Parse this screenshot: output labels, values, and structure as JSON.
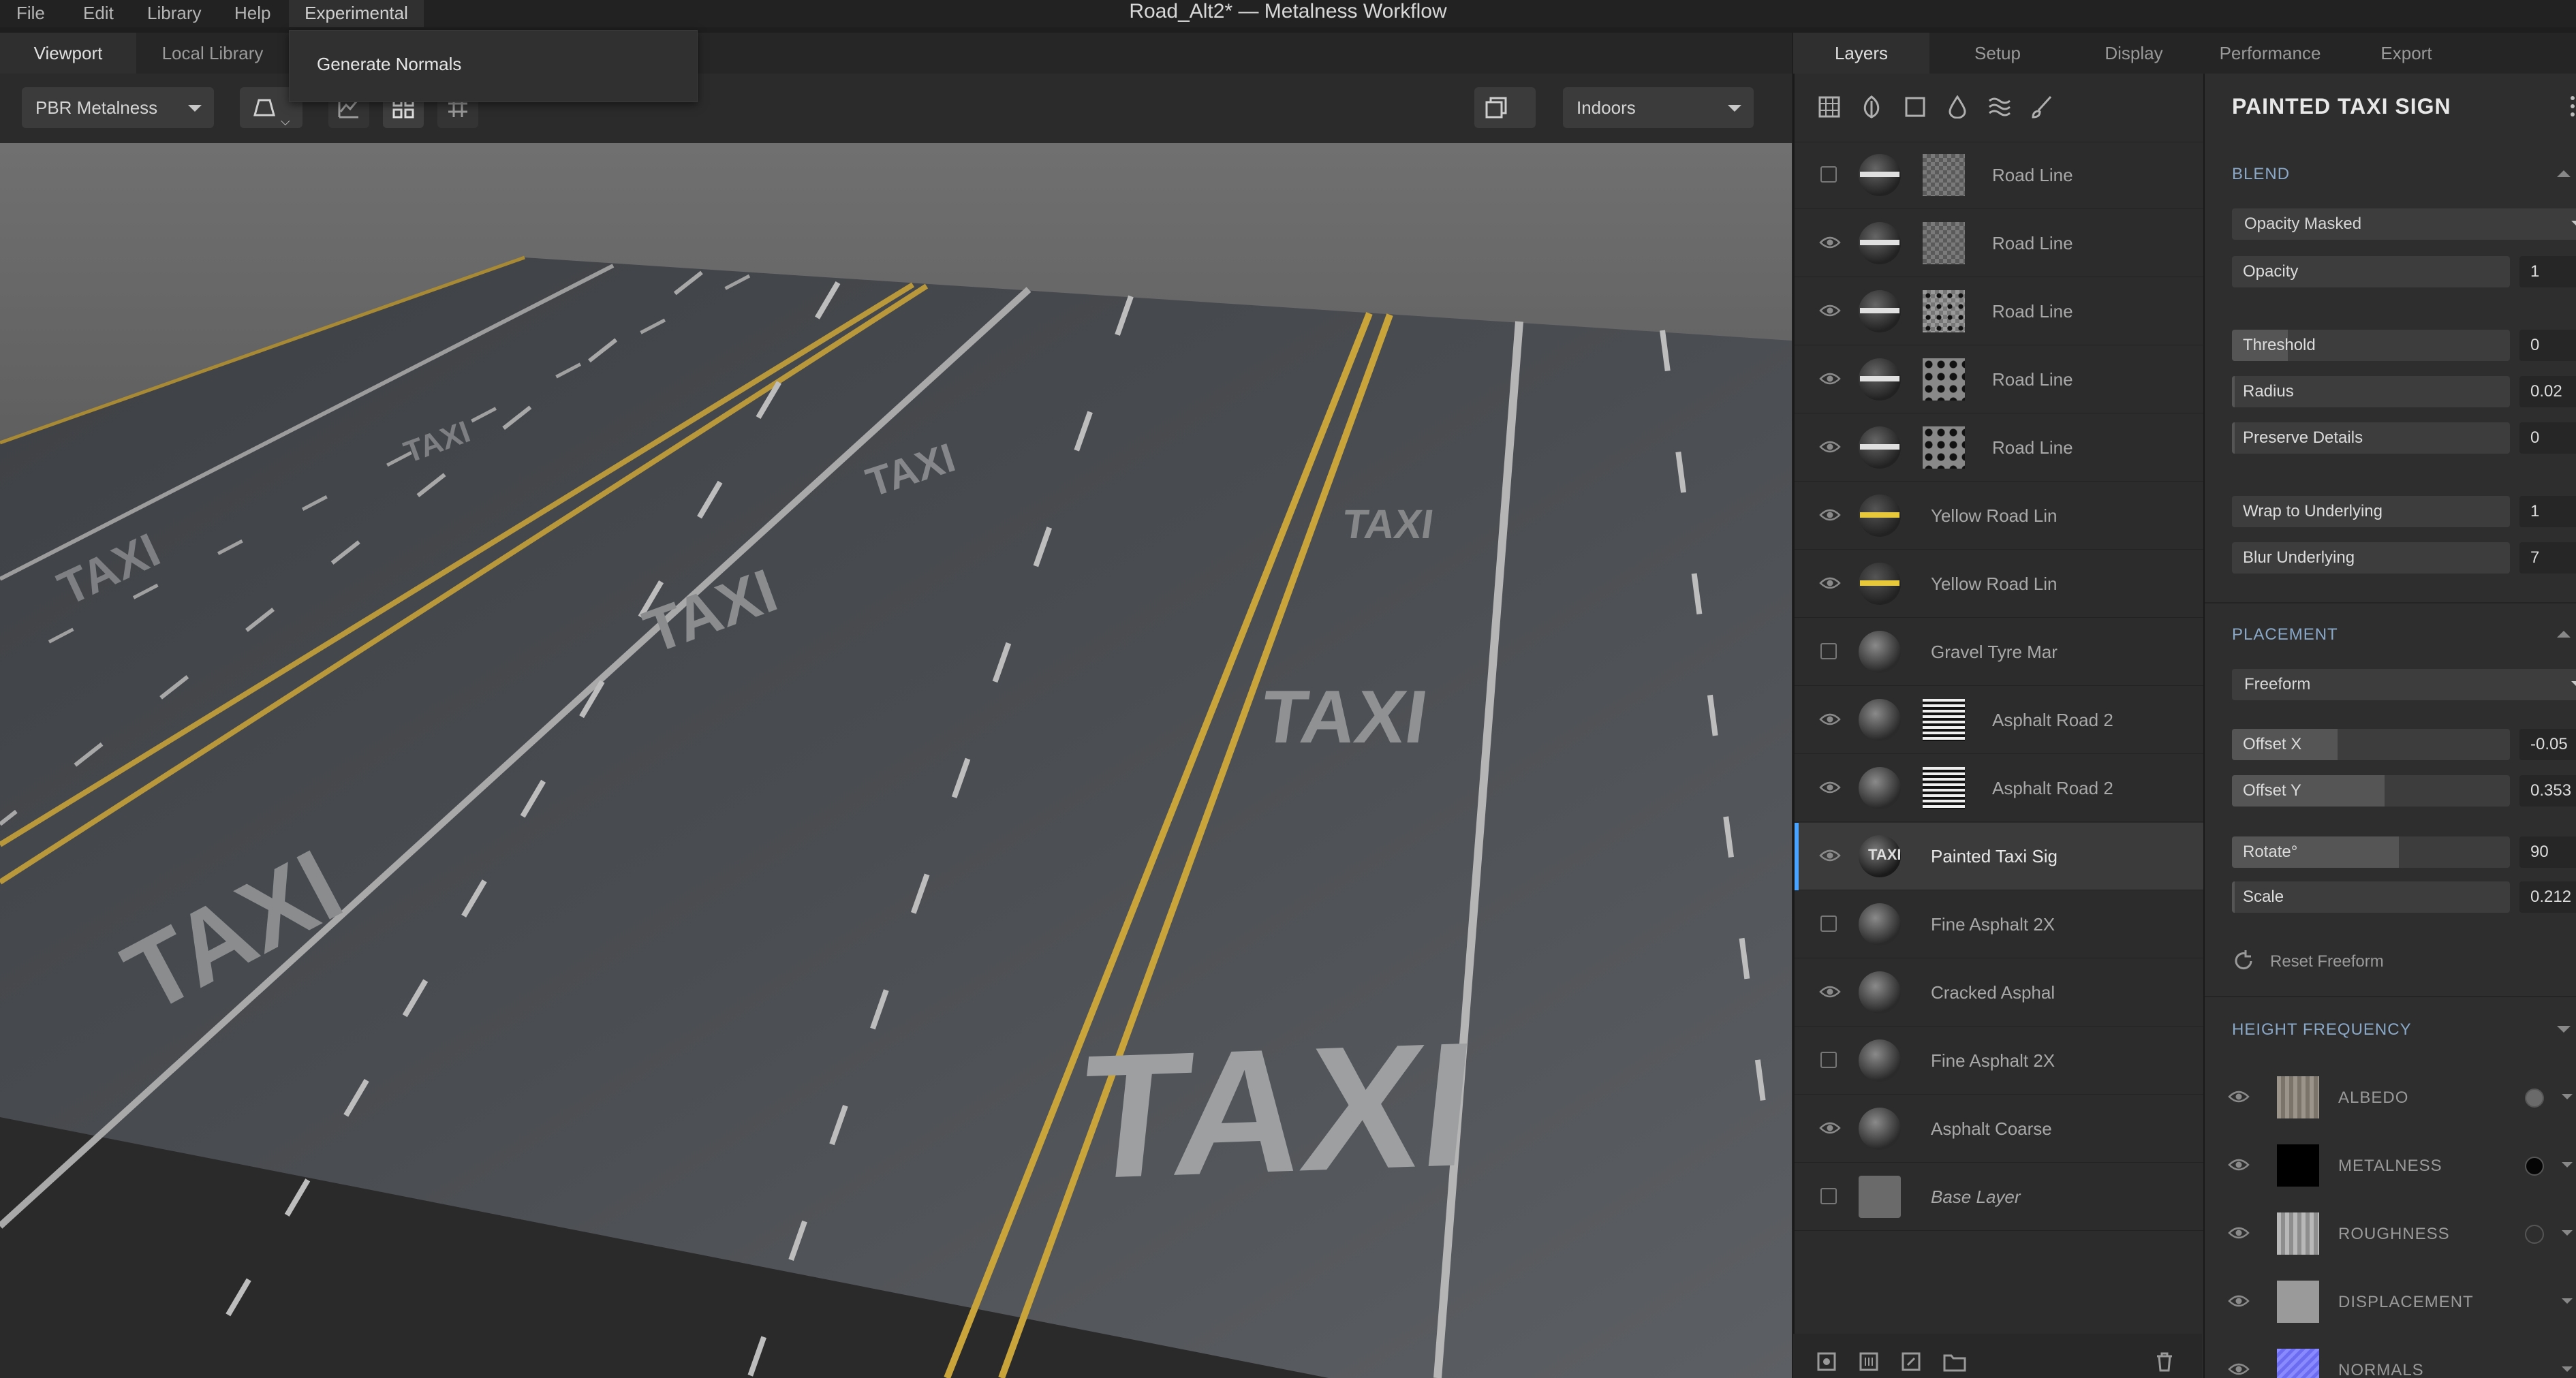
{
  "window": {
    "title": "Road_Alt2* — Metalness Workflow"
  },
  "menu": {
    "items": [
      "File",
      "Edit",
      "Library",
      "Help",
      "Experimental"
    ]
  },
  "experimental_menu": {
    "item": "Generate Normals"
  },
  "viewport_tabs": [
    "Viewport",
    "Local Library"
  ],
  "toolbar": {
    "shader": "PBR Metalness",
    "environment": "Indoors"
  },
  "right_tabs": [
    "Layers",
    "Setup",
    "Display",
    "Performance",
    "Export"
  ],
  "layers": [
    {
      "name": "Road Line",
      "visible": false,
      "mask": "checker"
    },
    {
      "name": "Road Line",
      "visible": true,
      "mask": "checker"
    },
    {
      "name": "Road Line",
      "visible": true,
      "mask": "dots"
    },
    {
      "name": "Road Line",
      "visible": true,
      "mask": "dots2"
    },
    {
      "name": "Road Line",
      "visible": true,
      "mask": "dots2"
    },
    {
      "name": "Yellow Road Lin",
      "visible": true,
      "mask": ""
    },
    {
      "name": "Yellow Road Lin",
      "visible": true,
      "mask": ""
    },
    {
      "name": "Gravel Tyre Mar",
      "visible": false,
      "mask": ""
    },
    {
      "name": "Asphalt Road 2",
      "visible": true,
      "mask": "stripes"
    },
    {
      "name": "Asphalt Road 2",
      "visible": true,
      "mask": "stripes"
    },
    {
      "name": "Painted Taxi Sig",
      "visible": true,
      "mask": "",
      "selected": true
    },
    {
      "name": "Fine Asphalt 2X",
      "visible": false,
      "mask": ""
    },
    {
      "name": "Cracked Asphal",
      "visible": true,
      "mask": ""
    },
    {
      "name": "Fine Asphalt 2X",
      "visible": false,
      "mask": ""
    },
    {
      "name": "Asphalt Coarse",
      "visible": true,
      "mask": ""
    },
    {
      "name": "Base Layer",
      "visible": false,
      "mask": "",
      "base": true
    }
  ],
  "properties": {
    "title": "PAINTED TAXI SIGN",
    "blend": {
      "label": "BLEND",
      "mode": "Opacity Masked",
      "opacity": {
        "label": "Opacity",
        "value": "1"
      },
      "threshold": {
        "label": "Threshold",
        "value": "0",
        "fraction": 0.2
      },
      "radius": {
        "label": "Radius",
        "value": "0.02",
        "fraction": 0.01
      },
      "preserve": {
        "label": "Preserve Details",
        "value": "0",
        "fraction": 0.01
      },
      "wrap": {
        "label": "Wrap to Underlying",
        "value": "1"
      },
      "blur": {
        "label": "Blur Underlying",
        "value": "7"
      }
    },
    "placement": {
      "label": "PLACEMENT",
      "mode": "Freeform",
      "offset_x": {
        "label": "Offset X",
        "value": "-0.05",
        "fraction": 0.38
      },
      "offset_y": {
        "label": "Offset Y",
        "value": "0.353",
        "fraction": 0.55
      },
      "rotate": {
        "label": "Rotate°",
        "value": "90",
        "fraction": 0.6
      },
      "scale": {
        "label": "Scale",
        "value": "0.212",
        "fraction": 0.01
      },
      "reset": "Reset Freeform"
    },
    "height_frequency": {
      "label": "HEIGHT FREQUENCY"
    },
    "maps": [
      {
        "name": "ALBEDO",
        "color": "#6a6a6a",
        "thumb": "#8a8478"
      },
      {
        "name": "METALNESS",
        "color": "#050505",
        "thumb": "#000000"
      },
      {
        "name": "ROUGHNESS",
        "color": "#2e2e2e",
        "thumb": "#a8a8a8"
      },
      {
        "name": "DISPLACEMENT",
        "color": "",
        "thumb": "#9a9a9a"
      },
      {
        "name": "NORMALS",
        "color": "",
        "thumb": "#7f7fff"
      }
    ]
  },
  "viewport_text": {
    "taxi": "TAXI"
  },
  "colors": {
    "accent": "#4aa3ff",
    "road": "#4b4e52",
    "yellow_line": "#c9a43a",
    "white_line": "#bfbfbf"
  }
}
